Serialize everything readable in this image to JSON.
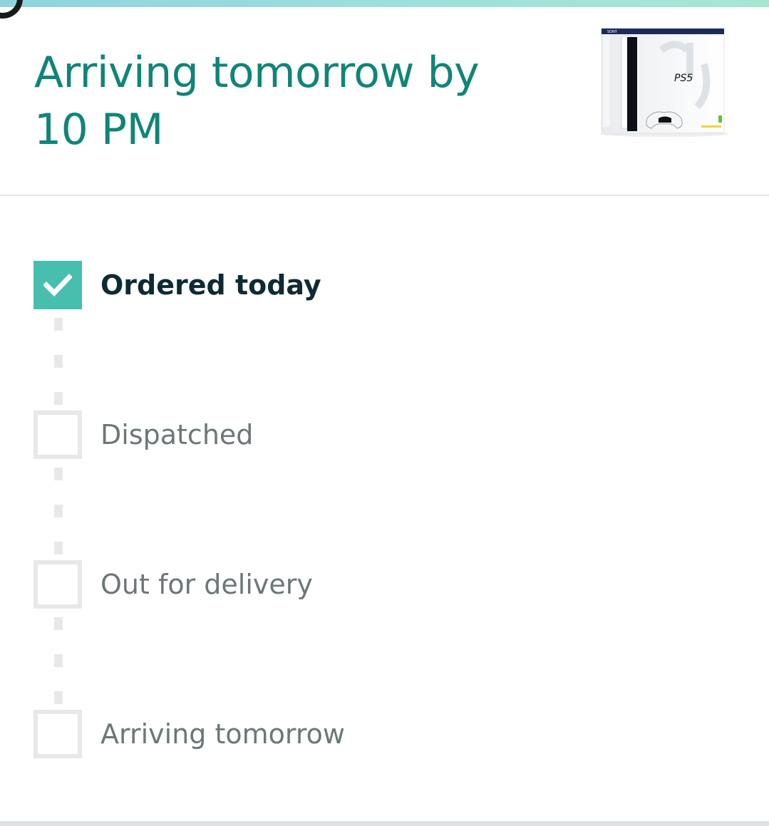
{
  "header": {
    "arrival_title": "Arriving tomorrow by 10 PM"
  },
  "product": {
    "brand_text": "SONY",
    "logo_text": "PS5",
    "image_icon": "ps5-box-image"
  },
  "tracker": {
    "accent_color": "#48bfae",
    "steps": [
      {
        "label": "Ordered today",
        "state": "completed"
      },
      {
        "label": "Dispatched",
        "state": "pending"
      },
      {
        "label": "Out for delivery",
        "state": "pending"
      },
      {
        "label": "Arriving tomorrow",
        "state": "pending"
      }
    ]
  }
}
